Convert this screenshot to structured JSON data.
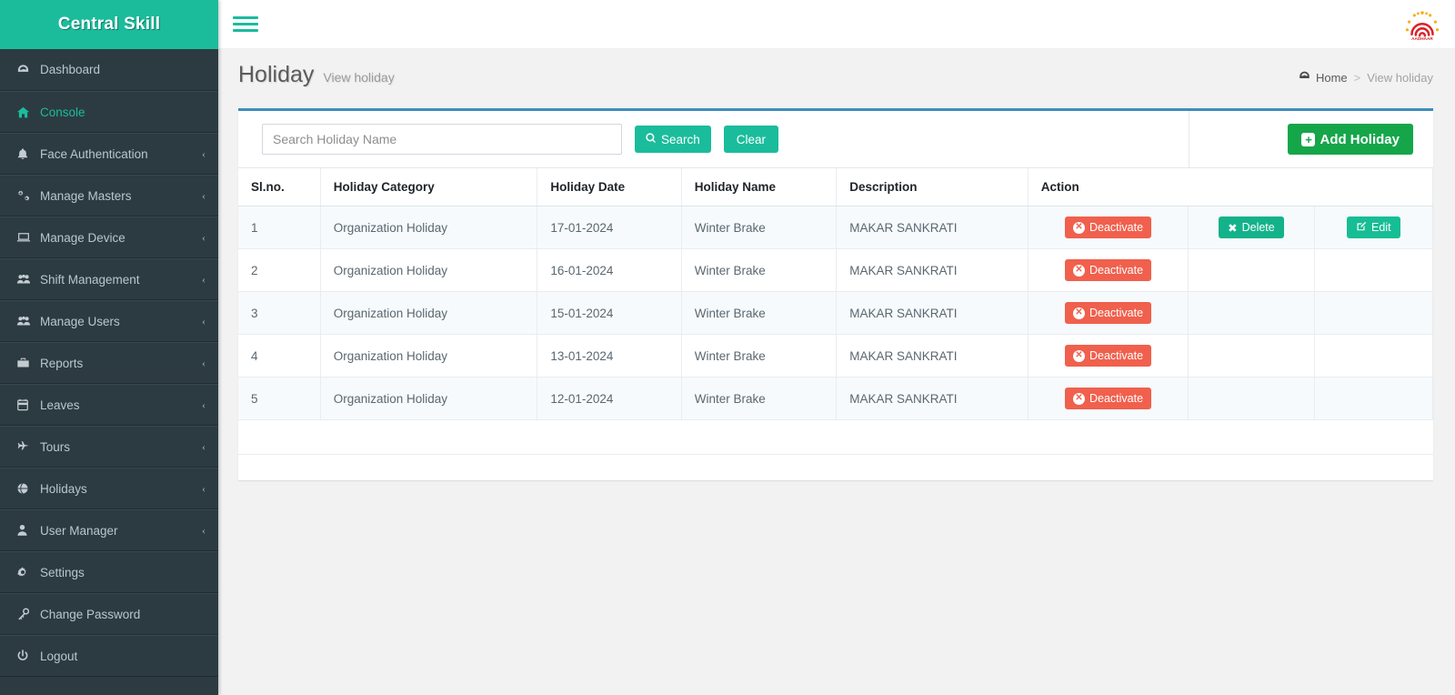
{
  "brand": {
    "name": "Central Skill",
    "bg": "#1abc9c"
  },
  "sidebar": {
    "items": [
      {
        "label": "Dashboard",
        "icon": "dashboard-icon",
        "caret": "",
        "active": false
      },
      {
        "label": "Console",
        "icon": "home-icon",
        "caret": "",
        "active": true
      },
      {
        "label": "Face Authentication",
        "icon": "bell-icon",
        "caret": "‹",
        "active": false
      },
      {
        "label": "Manage Masters",
        "icon": "gears-icon",
        "caret": "‹",
        "active": false
      },
      {
        "label": "Manage Device",
        "icon": "laptop-icon",
        "caret": "‹",
        "active": false
      },
      {
        "label": "Shift Management",
        "icon": "users-group-icon",
        "caret": "‹",
        "active": false
      },
      {
        "label": "Manage Users",
        "icon": "users-group-icon",
        "caret": "‹",
        "active": false
      },
      {
        "label": "Reports",
        "icon": "briefcase-icon",
        "caret": "‹",
        "active": false
      },
      {
        "label": "Leaves",
        "icon": "calendar-icon",
        "caret": "‹",
        "active": false
      },
      {
        "label": "Tours",
        "icon": "plane-icon",
        "caret": "‹",
        "active": false
      },
      {
        "label": "Holidays",
        "icon": "globe-icon",
        "caret": "‹",
        "active": false
      },
      {
        "label": "User Manager",
        "icon": "user-icon",
        "caret": "‹",
        "active": false
      },
      {
        "label": "Settings",
        "icon": "gear-icon",
        "caret": "",
        "active": false
      },
      {
        "label": "Change Password",
        "icon": "key-icon",
        "caret": "",
        "active": false
      },
      {
        "label": "Logout",
        "icon": "power-icon",
        "caret": "",
        "active": false
      }
    ]
  },
  "topbar": {
    "menu_toggle": "hamburger-icon",
    "logo_alt": "AADHAAR",
    "logo_caption": "AADHAAR"
  },
  "page": {
    "title": "Holiday",
    "subtitle": "View holiday",
    "breadcrumb": {
      "home": "Home",
      "separator": ">",
      "current": "View holiday"
    }
  },
  "toolbar": {
    "search_placeholder": "Search Holiday Name",
    "search_value": "",
    "search_label": "Search",
    "clear_label": "Clear",
    "add_label": "Add Holiday"
  },
  "table": {
    "columns": [
      "Sl.no.",
      "Holiday Category",
      "Holiday Date",
      "Holiday Name",
      "Description",
      "Action"
    ],
    "rows": [
      {
        "sl": "1",
        "category": "Organization Holiday",
        "date": "17-01-2024",
        "name": "Winter Brake",
        "description": "MAKAR SANKRATI",
        "deactivate": "Deactivate",
        "delete": "Delete",
        "edit": "Edit"
      },
      {
        "sl": "2",
        "category": "Organization Holiday",
        "date": "16-01-2024",
        "name": "Winter Brake",
        "description": "MAKAR SANKRATI",
        "deactivate": "Deactivate",
        "delete": "",
        "edit": ""
      },
      {
        "sl": "3",
        "category": "Organization Holiday",
        "date": "15-01-2024",
        "name": "Winter Brake",
        "description": "MAKAR SANKRATI",
        "deactivate": "Deactivate",
        "delete": "",
        "edit": ""
      },
      {
        "sl": "4",
        "category": "Organization Holiday",
        "date": "13-01-2024",
        "name": "Winter Brake",
        "description": "MAKAR SANKRATI",
        "deactivate": "Deactivate",
        "delete": "",
        "edit": ""
      },
      {
        "sl": "5",
        "category": "Organization Holiday",
        "date": "12-01-2024",
        "name": "Winter Brake",
        "description": "MAKAR SANKRATI",
        "deactivate": "Deactivate",
        "delete": "",
        "edit": ""
      }
    ]
  },
  "colors": {
    "brand_teal": "#1abc9c",
    "sidebar_bg": "#2c3b41",
    "card_top_border": "#3c8dbc",
    "danger": "#f0604d",
    "success_green": "#15a64a"
  }
}
